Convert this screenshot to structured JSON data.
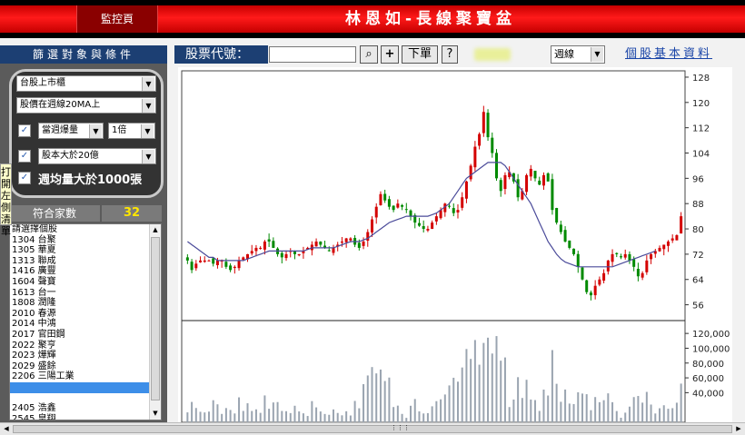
{
  "header": {
    "monitor_tab": "監控頁",
    "title": "林恩如-長線聚寶盆"
  },
  "toolbar": {
    "filter_heading": "篩選對象與條件",
    "stock_code_label": "股票代號：",
    "search_icon": "⌕",
    "add_label": "+",
    "order_label": "下單",
    "help_label": "?",
    "period_value": "週線",
    "basic_info_label": "個股基本資料"
  },
  "filters": {
    "market_select": "台股上市櫃",
    "ma_select": "股價在週線20MA上",
    "volume_checked": true,
    "volume_select": "當週爆量",
    "multiple_select": "1倍",
    "capital_checked": true,
    "capital_select": "股本大於20億",
    "weekly_checked": true,
    "weekly_label": "週均量大於1000張"
  },
  "side_tab": "打開左側清單",
  "match": {
    "label": "符合家數",
    "count": "32"
  },
  "stock_list": [
    "請選擇個股",
    "1304 台聚",
    "1305 華夏",
    "1313 聯成",
    "1416 廣豐",
    "1604 聲寶",
    "1613 台一",
    "1808 潤隆",
    "2010 春源",
    "2014 中鴻",
    "2017 官田鋼",
    "2022 聚亨",
    "2023 燁輝",
    "2029 盛餘",
    "2206 三陽工業",
    "",
    "",
    "2405 浩鑫",
    "2545 皇翔"
  ],
  "chart_data": {
    "type": "candlestick",
    "price_axis": {
      "ticks": [
        56,
        64,
        72,
        80,
        88,
        96,
        104,
        112,
        120,
        128
      ],
      "range": [
        51,
        130
      ]
    },
    "volume_axis": {
      "ticks": [
        "120,000",
        "100,000",
        "80,000",
        "60,000",
        "40,000"
      ],
      "values": [
        120000,
        100000,
        80000,
        60000,
        40000
      ],
      "range": [
        0,
        130000
      ]
    },
    "up_color": "#d40000",
    "down_color": "#008a00",
    "ma_color": "#4b4b9a",
    "series": {
      "close": [
        70,
        67,
        69,
        70,
        70,
        70,
        69,
        70,
        70,
        68,
        67,
        68,
        70,
        71,
        72,
        73,
        74,
        74,
        76,
        76,
        74,
        72,
        71,
        72,
        73,
        72,
        72,
        73,
        74,
        75,
        76,
        75,
        74,
        73,
        74,
        75,
        76,
        77,
        77,
        75,
        74,
        76,
        79,
        83,
        87,
        91,
        89,
        87,
        86,
        88,
        87,
        86,
        84,
        82,
        81,
        80,
        80,
        82,
        84,
        86,
        88,
        87,
        85,
        86,
        90,
        95,
        100,
        106,
        110,
        117,
        109,
        104,
        96,
        92,
        97,
        98,
        95,
        90,
        92,
        97,
        99,
        96,
        94,
        97,
        95,
        86,
        82,
        79,
        76,
        74,
        72,
        68,
        64,
        60,
        59,
        62,
        64,
        66,
        70,
        72,
        72,
        71,
        72,
        70,
        68,
        65,
        66,
        70,
        72,
        73,
        74,
        75,
        76,
        77,
        78,
        84
      ],
      "ma20": [
        76,
        75,
        74,
        73,
        72,
        71,
        71,
        70,
        70,
        70,
        70,
        70,
        70,
        70,
        70.5,
        71,
        71.5,
        72,
        72.5,
        73,
        73,
        73,
        73,
        73,
        73,
        73,
        73,
        73,
        73.5,
        74,
        74,
        74,
        74,
        74,
        74,
        74.5,
        75,
        75.5,
        76,
        76,
        76,
        76.5,
        77,
        78,
        79,
        80,
        81,
        82,
        82.5,
        83,
        83.5,
        84,
        84,
        84,
        84,
        84,
        84,
        84.5,
        85,
        86,
        87,
        88,
        90,
        92,
        94,
        96,
        97,
        98,
        99,
        100,
        101,
        101,
        101,
        101,
        100,
        98,
        96,
        94,
        92,
        90,
        88,
        85,
        82,
        79,
        76,
        74,
        72,
        70.5,
        69.5,
        69,
        68.5,
        68,
        68,
        68,
        68,
        68,
        68,
        68,
        68,
        68,
        68.5,
        69,
        69.5,
        70,
        70.5,
        71,
        71.5,
        72,
        72.5,
        73
      ]
    },
    "volume_note": "weekly volume bars under price panel"
  }
}
